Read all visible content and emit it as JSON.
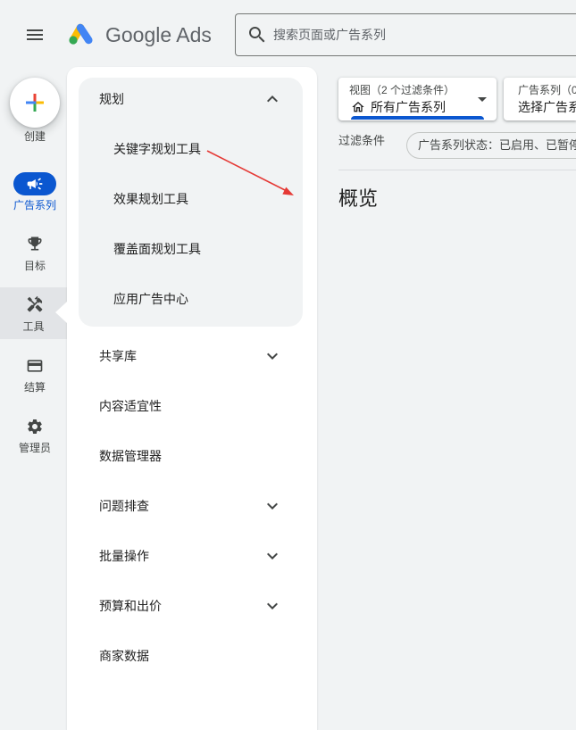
{
  "header": {
    "menu_icon": "menu-icon",
    "logo_icon": "google-ads-logo-icon",
    "product_name": "Google Ads",
    "search": {
      "icon": "search-icon",
      "placeholder": "搜索页面或广告系列"
    }
  },
  "rail": {
    "create": {
      "icon": "create-plus-icon",
      "label": "创建"
    },
    "items": [
      {
        "label": "广告系列",
        "icon": "campaign-megaphone-icon",
        "selected": true
      },
      {
        "label": "目标",
        "icon": "trophy-icon",
        "selected": false
      },
      {
        "label": "工具",
        "icon": "tools-icon",
        "selected": false,
        "hovered": true
      },
      {
        "label": "结算",
        "icon": "credit-card-icon",
        "selected": false
      },
      {
        "label": "管理员",
        "icon": "settings-gear-icon",
        "selected": false
      }
    ]
  },
  "flyout": {
    "planning": {
      "label": "规划",
      "expanded": true,
      "icon": "chevron-up-icon",
      "items": [
        "关键字规划工具",
        "效果规划工具",
        "覆盖面规划工具",
        "应用广告中心"
      ]
    },
    "sections": [
      {
        "label": "共享库",
        "icon": "chevron-down-icon"
      },
      {
        "label": "内容适宜性"
      },
      {
        "label": "数据管理器"
      },
      {
        "label": "问题排查",
        "icon": "chevron-down-icon"
      },
      {
        "label": "批量操作",
        "icon": "chevron-down-icon"
      },
      {
        "label": "预算和出价",
        "icon": "chevron-down-icon"
      },
      {
        "label": "商家数据"
      }
    ]
  },
  "main": {
    "view_selector": {
      "label": "视图（2 个过滤条件）",
      "value": "所有广告系列",
      "icon": "home-icon"
    },
    "campaign_selector": {
      "label": "广告系列（0",
      "value": "选择广告系"
    },
    "filters": {
      "label": "过滤条件",
      "chip": "广告系列状态：已启用、已暂停"
    },
    "page_title": "概览"
  },
  "colors": {
    "accent": "#0b57d0",
    "annotation": "#e53935",
    "text": "#1f1f1f",
    "muted": "#444746",
    "surface": "#f1f3f4"
  }
}
